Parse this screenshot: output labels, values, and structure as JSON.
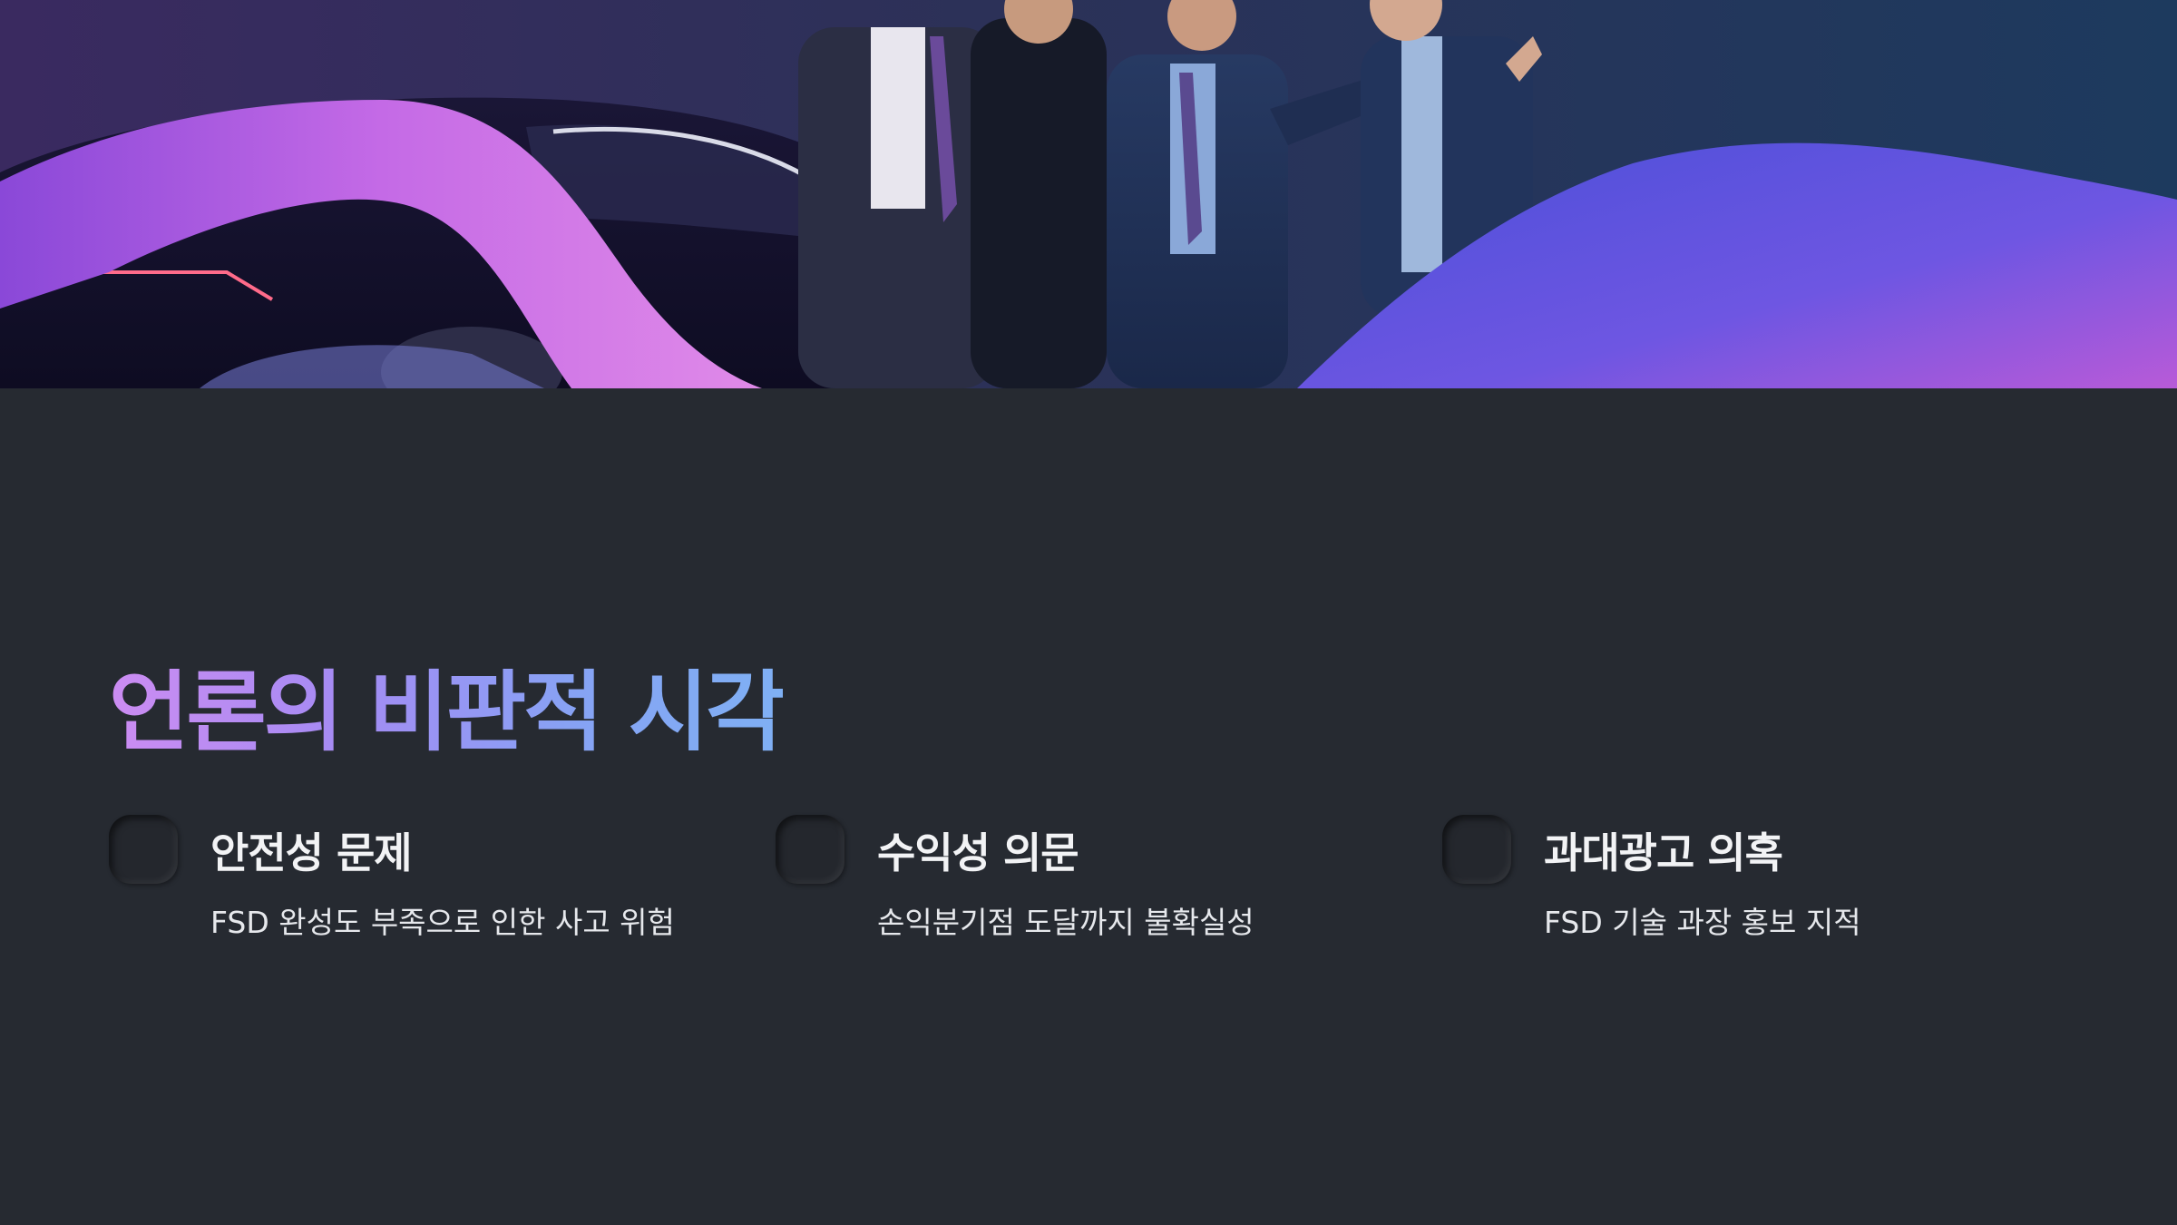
{
  "slide": {
    "title": "언론의 비판적 시각",
    "features": [
      {
        "title": "안전성 문제",
        "description": "FSD 완성도 부족으로 인한 사고 위험"
      },
      {
        "title": "수익성 의문",
        "description": "손익분기점 도달까지 불확실성"
      },
      {
        "title": "과대광고 의혹",
        "description": "FSD 기술 과장 홍보 지적"
      }
    ]
  },
  "colors": {
    "background": "#262a31",
    "title_gradient_start": "#cc8cf2",
    "title_gradient_end": "#7fb0f4",
    "text": "#f2f3f5"
  }
}
